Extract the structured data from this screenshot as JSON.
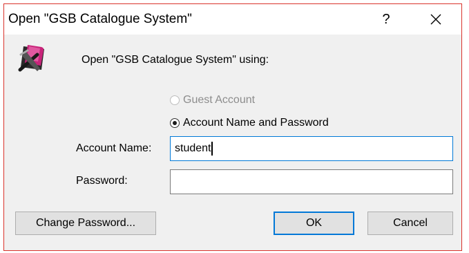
{
  "window": {
    "title": "Open \"GSB Catalogue System\"",
    "help_label": "?",
    "close_label": "close"
  },
  "prompt": "Open \"GSB Catalogue System\" using:",
  "login_options": {
    "guest_label": "Guest Account",
    "guest_enabled": false,
    "account_label": "Account Name and Password",
    "selected": "account"
  },
  "fields": {
    "account_name_label": "Account Name:",
    "account_name_value": "student",
    "password_label": "Password:",
    "password_value": ""
  },
  "buttons": {
    "change_password": "Change Password...",
    "ok": "OK",
    "cancel": "Cancel"
  },
  "colors": {
    "focus_accent": "#0078d7",
    "frame_border": "#d9322b",
    "dialog_background": "#f0f0f0"
  },
  "icons": {
    "app": "filemaker-app-icon",
    "close": "close-icon"
  }
}
